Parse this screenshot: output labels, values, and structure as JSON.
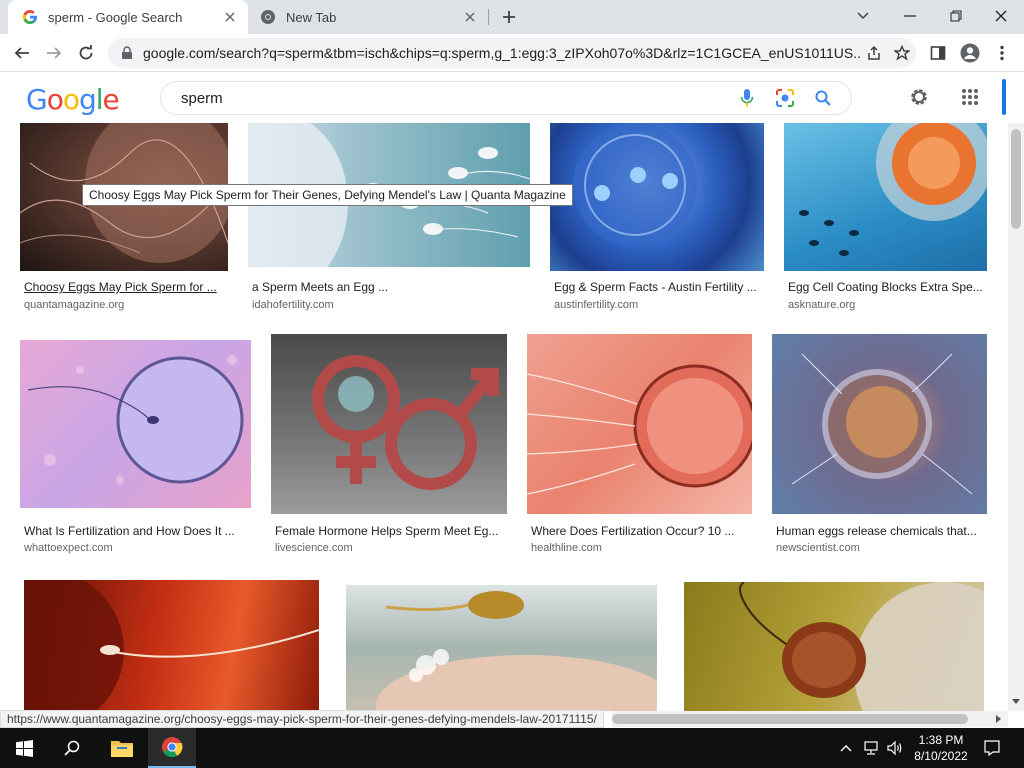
{
  "browser": {
    "tabs": [
      {
        "title": "sperm - Google Search",
        "favicon": "google-g-icon"
      },
      {
        "title": "New Tab",
        "favicon": "chrome-icon"
      }
    ],
    "url": "google.com/search?q=sperm&tbm=isch&chips=q:sperm,g_1:egg:3_zIPXoh07o%3D&rlz=1C1GCEA_enUS1011US..."
  },
  "search": {
    "query": "sperm"
  },
  "results": [
    {
      "caption": "Choosy Eggs May Pick Sperm for ...",
      "source": "quantamagazine.org"
    },
    {
      "caption": "a Sperm Meets an Egg ...",
      "source": "idahofertility.com"
    },
    {
      "caption": "Egg & Sperm Facts - Austin Fertility ...",
      "source": "austinfertility.com"
    },
    {
      "caption": "Egg Cell Coating Blocks Extra Spe...",
      "source": "asknature.org"
    },
    {
      "caption": "What Is Fertilization and How Does It ...",
      "source": "whattoexpect.com"
    },
    {
      "caption": "Female Hormone Helps Sperm Meet Eg...",
      "source": "livescience.com"
    },
    {
      "caption": "Where Does Fertilization Occur? 10 ...",
      "source": "healthline.com"
    },
    {
      "caption": "Human eggs release chemicals that...",
      "source": "newscientist.com"
    },
    {
      "caption": "",
      "source": ""
    },
    {
      "caption": "",
      "source": ""
    },
    {
      "caption": "",
      "source": ""
    }
  ],
  "tooltip": "Choosy Eggs May Pick Sperm for Their Genes, Defying Mendel's Law | Quanta  Magazine",
  "status_url": "https://www.quantamagazine.org/choosy-eggs-may-pick-sperm-for-their-genes-defying-mendels-law-20171115/",
  "taskbar": {
    "time": "1:38 PM",
    "date": "8/10/2022"
  }
}
